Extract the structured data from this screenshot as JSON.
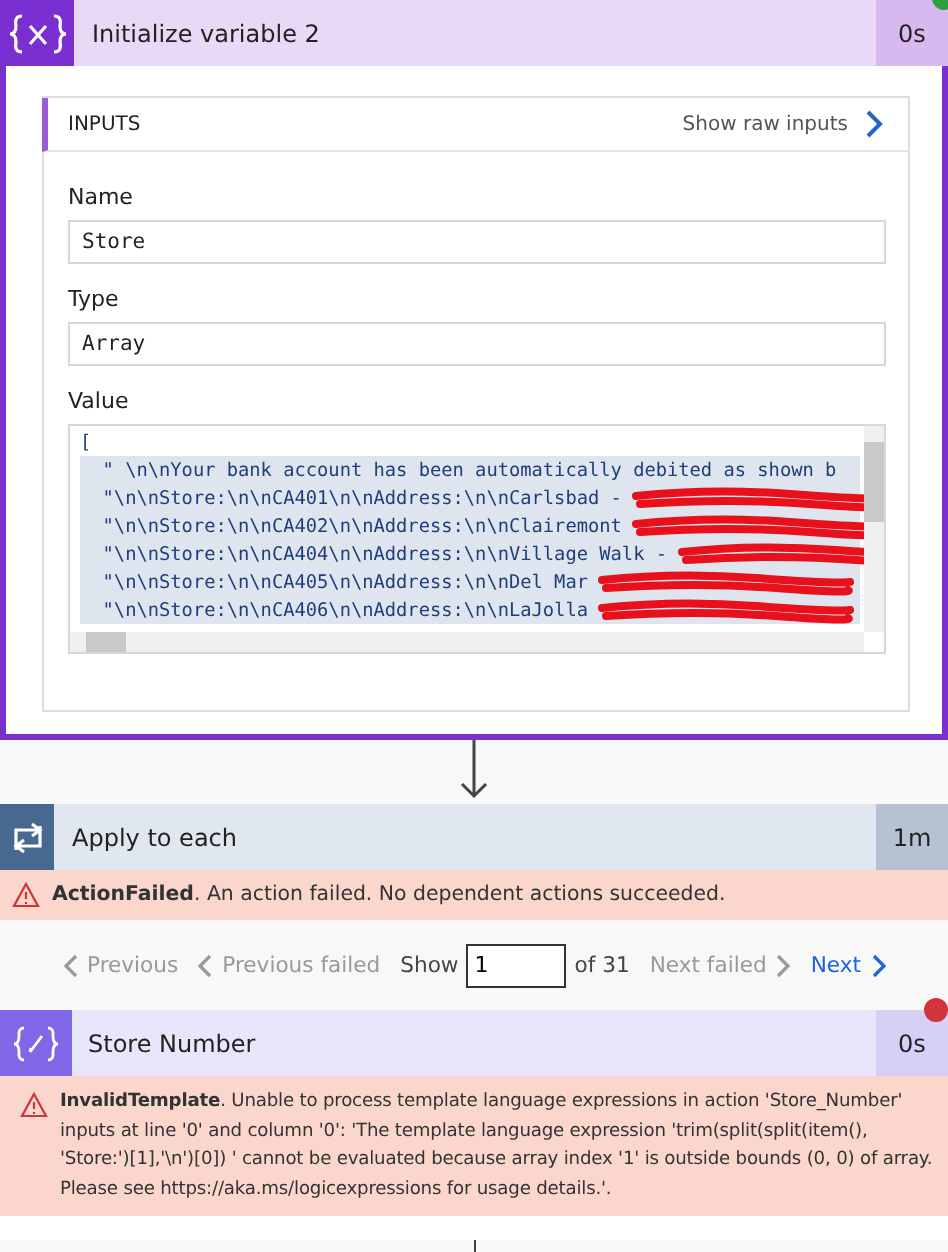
{
  "variable_card": {
    "title": "Initialize variable 2",
    "duration": "0s",
    "failed": false,
    "inputs": {
      "heading": "INPUTS",
      "raw_link": "Show raw inputs",
      "fields": [
        {
          "label": "Name",
          "value": "Store"
        },
        {
          "label": "Type",
          "value": "Array"
        }
      ],
      "value_label": "Value",
      "code_lines": [
        {
          "text": "[",
          "redacted": false
        },
        {
          "text": "  \" \\n\\nYour bank account has been automatically debited as shown b",
          "redacted": false
        },
        {
          "text": "  \"\\n\\nStore:\\n\\nCA401\\n\\nAddress:\\n\\nCarlsbad -",
          "redacted": true
        },
        {
          "text": "  \"\\n\\nStore:\\n\\nCA402\\n\\nAddress:\\n\\nClairemont",
          "redacted": true
        },
        {
          "text": "  \"\\n\\nStore:\\n\\nCA404\\n\\nAddress:\\n\\nVillage Walk -",
          "redacted": true
        },
        {
          "text": "  \"\\n\\nStore:\\n\\nCA405\\n\\nAddress:\\n\\nDel Mar",
          "redacted": true
        },
        {
          "text": "  \"\\n\\nStore:\\n\\nCA406\\n\\nAddress:\\n\\nLaJolla",
          "redacted": true
        }
      ]
    }
  },
  "loop_card": {
    "title": "Apply to each",
    "duration": "1m",
    "error": "**ActionFailed**. An action failed. No dependent actions succeeded."
  },
  "pagination": {
    "items": [
      {
        "label": "Previous",
        "kind": "prev",
        "disabled": true
      },
      {
        "label": "Previous failed",
        "kind": "prev",
        "disabled": true
      }
    ],
    "show_label": "Show",
    "page_value": "1",
    "total": "of 31",
    "after": [
      {
        "label": "Next failed",
        "kind": "next",
        "disabled": true
      },
      {
        "label": "Next",
        "kind": "next",
        "disabled": false
      }
    ]
  },
  "compose_card": {
    "title": "Store Number",
    "duration": "0s",
    "failed": true,
    "error": "**InvalidTemplate**. Unable to process template language expressions in action 'Store_Number' inputs at line '0' and column '0': 'The template language expression 'trim(split(split(item(), 'Store:')[1],'\\n')[0]) ' cannot be evaluated because array index '1' is outside bounds (0, 0) of array. Please see https://aka.ms/logicexpressions for usage details.'."
  }
}
